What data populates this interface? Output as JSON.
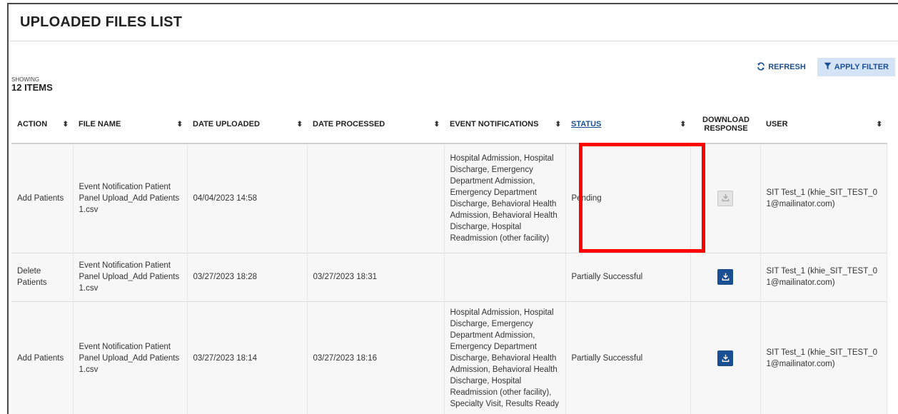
{
  "page": {
    "title": "UPLOADED FILES LIST"
  },
  "toolbar": {
    "refresh_label": "REFRESH",
    "apply_filter_label": "APPLY FILTER"
  },
  "summary": {
    "showing_label": "SHOWING",
    "count_label": "12 ITEMS"
  },
  "table": {
    "columns": [
      {
        "label": "ACTION",
        "sortable": true
      },
      {
        "label": "FILE NAME",
        "sortable": true
      },
      {
        "label": "DATE UPLOADED",
        "sortable": true
      },
      {
        "label": "DATE PROCESSED",
        "sortable": true
      },
      {
        "label": "EVENT NOTIFICATIONS",
        "sortable": true
      },
      {
        "label": "STATUS",
        "sortable": true
      },
      {
        "label": "DOWNLOAD RESPONSE",
        "sortable": false
      },
      {
        "label": "USER",
        "sortable": true
      }
    ],
    "rows": [
      {
        "action": "Add Patients",
        "file_name": "Event Notification Patient Panel Upload_Add Patients 1.csv",
        "date_uploaded": "04/04/2023 14:58",
        "date_processed": "",
        "event_notifications": "Hospital Admission, Hospital Discharge, Emergency Department Admission, Emergency Department Discharge, Behavioral Health Admission, Behavioral Health Discharge, Hospital Readmission (other facility)",
        "status": "Pending",
        "download_enabled": false,
        "user": "SIT Test_1 (khie_SIT_TEST_01@mailinator.com)"
      },
      {
        "action": "Delete Patients",
        "file_name": "Event Notification Patient Panel Upload_Add Patients 1.csv",
        "date_uploaded": "03/27/2023 18:28",
        "date_processed": "03/27/2023 18:31",
        "event_notifications": "",
        "status": "Partially Successful",
        "download_enabled": true,
        "user": "SIT Test_1 (khie_SIT_TEST_01@mailinator.com)"
      },
      {
        "action": "Add Patients",
        "file_name": "Event Notification Patient Panel Upload_Add Patients 1.csv",
        "date_uploaded": "03/27/2023 18:14",
        "date_processed": "03/27/2023 18:16",
        "event_notifications": "Hospital Admission, Hospital Discharge, Emergency Department Admission, Emergency Department Discharge, Behavioral Health Admission, Behavioral Health Discharge, Hospital Readmission (other facility), Specialty Visit, Results Ready",
        "status": "Partially Successful",
        "download_enabled": true,
        "user": "SIT Test_1 (khie_SIT_TEST_01@mailinator.com)"
      }
    ]
  },
  "icons": {
    "refresh": "refresh-icon",
    "filter": "filter-icon",
    "sort": "sort-icon",
    "download": "download-icon"
  },
  "colors": {
    "accent": "#1a4f94",
    "filter_bg": "#d4e4f6",
    "highlight": "#ff0000",
    "row_bg": "#f7f7f7"
  }
}
